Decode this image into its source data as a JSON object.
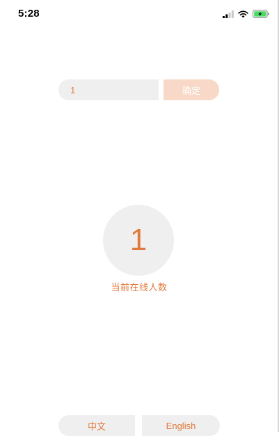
{
  "status_bar": {
    "time": "5:28",
    "icons": [
      "cellular-signal-icon",
      "wifi-icon",
      "battery-charging-icon"
    ],
    "battery_color": "#4cd964"
  },
  "input_row": {
    "value": "1",
    "confirm_label": "确定"
  },
  "online": {
    "count": "1",
    "caption": "当前在线人数"
  },
  "language": {
    "chinese_label": "中文",
    "english_label": "English"
  },
  "colors": {
    "accent": "#e07a3c",
    "confirm_bg": "#f8d8c6",
    "control_bg": "#efefef"
  }
}
